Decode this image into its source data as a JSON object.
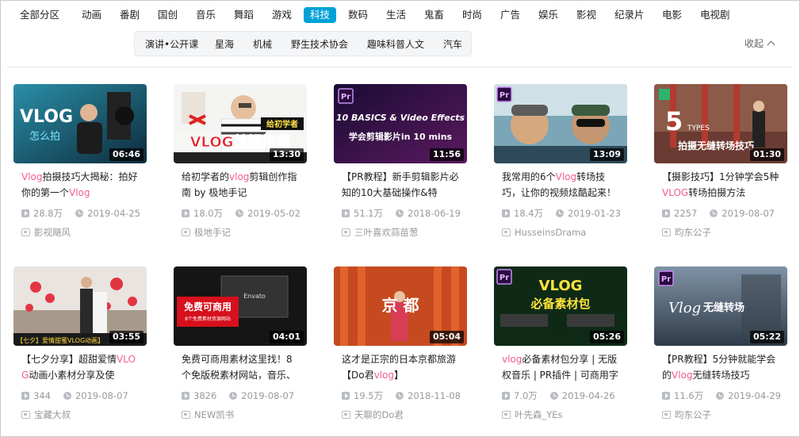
{
  "categories": [
    {
      "label": "全部分区",
      "active": false
    },
    {
      "label": "动画",
      "active": false
    },
    {
      "label": "番剧",
      "active": false
    },
    {
      "label": "国创",
      "active": false
    },
    {
      "label": "音乐",
      "active": false
    },
    {
      "label": "舞蹈",
      "active": false
    },
    {
      "label": "游戏",
      "active": false
    },
    {
      "label": "科技",
      "active": true
    },
    {
      "label": "数码",
      "active": false
    },
    {
      "label": "生活",
      "active": false
    },
    {
      "label": "鬼畜",
      "active": false
    },
    {
      "label": "时尚",
      "active": false
    },
    {
      "label": "广告",
      "active": false
    },
    {
      "label": "娱乐",
      "active": false
    },
    {
      "label": "影视",
      "active": false
    },
    {
      "label": "纪录片",
      "active": false
    },
    {
      "label": "电影",
      "active": false
    },
    {
      "label": "电视剧",
      "active": false
    }
  ],
  "subcategories": [
    "演讲•公开课",
    "星海",
    "机械",
    "野生技术协会",
    "趣味科普人文",
    "汽车"
  ],
  "collapse_label": "收起",
  "colors": {
    "accent": "#00a1d6",
    "highlight": "#f25d8e",
    "meta": "#999999"
  },
  "videos": [
    {
      "duration": "06:46",
      "title_parts": [
        {
          "t": "Vlog",
          "hl": true
        },
        {
          "t": "拍摄技巧大揭秘：拍好你的第一个",
          "hl": false
        },
        {
          "t": "Vlog",
          "hl": true
        }
      ],
      "views": "28.8万",
      "date": "2019-04-25",
      "uploader": "影视飓风",
      "thumb_text": "VLOG 怎么拍",
      "thumb_style": "vlog1"
    },
    {
      "duration": "13:30",
      "title_parts": [
        {
          "t": "给初学者的",
          "hl": false
        },
        {
          "t": "vlog",
          "hl": true
        },
        {
          "t": "剪辑创作指南 by 极地手记",
          "hl": false
        }
      ],
      "views": "18.0万",
      "date": "2019-05-02",
      "uploader": "极地手记",
      "thumb_text": "VLOG剪辑指南",
      "thumb_sub": "给初学者",
      "thumb_style": "guide"
    },
    {
      "duration": "11:56",
      "title_parts": [
        {
          "t": "【PR教程】新手剪辑影片必知的10大基础操作&特",
          "hl": false
        }
      ],
      "views": "51.1万",
      "date": "2018-06-19",
      "uploader": "三叶喜欢蒜苗葱",
      "thumb_text": "10 BASICS & Video Effects",
      "thumb_sub": "学会剪辑影片in 10 mins",
      "thumb_style": "pr10"
    },
    {
      "duration": "13:09",
      "title_parts": [
        {
          "t": "我常用的6个",
          "hl": false
        },
        {
          "t": "Vlog",
          "hl": true
        },
        {
          "t": "转场技巧，让你的视频炫酷起来！",
          "hl": false
        }
      ],
      "views": "18.4万",
      "date": "2019-01-23",
      "uploader": "HusseinsDrama",
      "thumb_text": "Pr",
      "thumb_style": "faces"
    },
    {
      "duration": "01:30",
      "title_parts": [
        {
          "t": "【摄影技巧】1分钟学会5种",
          "hl": false
        },
        {
          "t": "VLOG",
          "hl": true
        },
        {
          "t": "转场拍摄方法",
          "hl": false
        }
      ],
      "views": "2257",
      "date": "2019-08-07",
      "uploader": "昀东公子",
      "thumb_text": "5 TYPES",
      "thumb_sub": "拍摄无缝转场技巧",
      "thumb_style": "types5"
    },
    {
      "duration": "03:55",
      "title_parts": [
        {
          "t": "【七夕分享】超甜爱情",
          "hl": false
        },
        {
          "t": "VLOG",
          "hl": true
        },
        {
          "t": "动画小素材分享及使",
          "hl": false
        }
      ],
      "views": "344",
      "date": "2019-08-07",
      "uploader": "宝藏大叔",
      "thumb_text": "【七夕】爱情甜蜜VLOG动画】",
      "thumb_style": "love"
    },
    {
      "duration": "04:01",
      "title_parts": [
        {
          "t": "免费可商用素材这里找！8个免版税素材网站，音乐、",
          "hl": false
        }
      ],
      "views": "3826",
      "date": "2019-08-07",
      "uploader": "NEW凯书",
      "thumb_text": "免费可商用",
      "thumb_sub": "8个免费素材资源网站",
      "thumb_style": "free"
    },
    {
      "duration": "05:04",
      "title_parts": [
        {
          "t": "这才是正宗的日本京都旅游【Do君",
          "hl": false
        },
        {
          "t": "vlog",
          "hl": true
        },
        {
          "t": "】",
          "hl": false
        }
      ],
      "views": "19.5万",
      "date": "2018-11-08",
      "uploader": "天聊的Do君",
      "thumb_text": "京 都",
      "thumb_style": "kyoto"
    },
    {
      "duration": "05:26",
      "title_parts": [
        {
          "t": "vlog",
          "hl": true
        },
        {
          "t": "必备素材包分享 | 无版权音乐 | PR插件 | 可商用字",
          "hl": false
        }
      ],
      "views": "7.0万",
      "date": "2019-04-26",
      "uploader": "叶先森_YEs",
      "thumb_text": "VLOG",
      "thumb_sub": "必备素材包",
      "thumb_style": "kit"
    },
    {
      "duration": "05:22",
      "title_parts": [
        {
          "t": "【PR教程】5分钟就能学会的",
          "hl": false
        },
        {
          "t": "Vlog",
          "hl": true
        },
        {
          "t": "无缝转场技巧",
          "hl": false
        }
      ],
      "views": "11.6万",
      "date": "2019-04-29",
      "uploader": "昀东公子",
      "thumb_text": "Vlog",
      "thumb_sub": "无缝转场",
      "thumb_style": "seam"
    }
  ]
}
